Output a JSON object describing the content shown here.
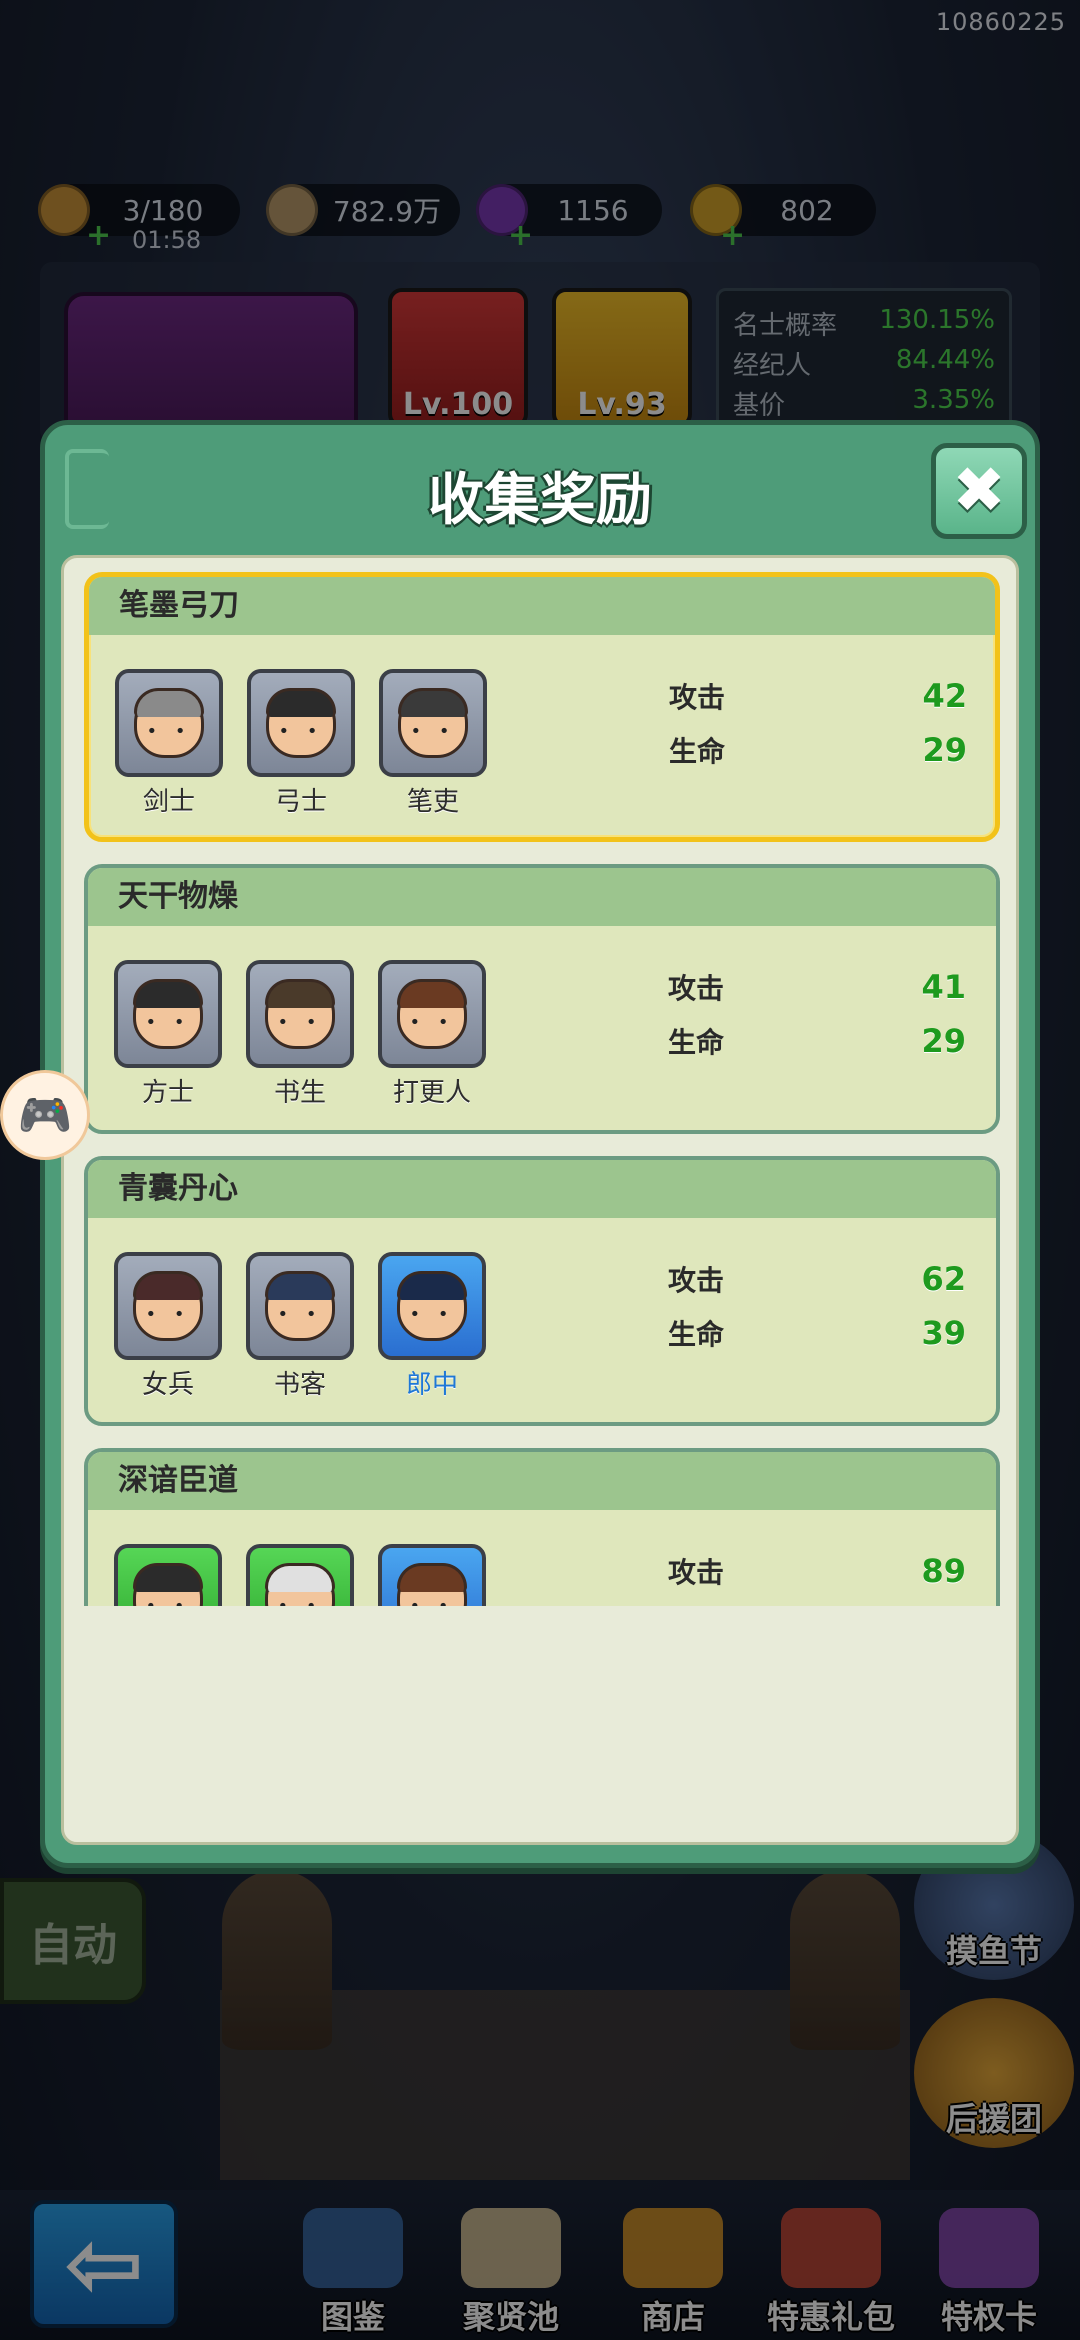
{
  "session_id": "10860225",
  "resources": {
    "stamina": {
      "value": "3/180",
      "timer": "01:58",
      "icon": "stamina-icon",
      "color": "#c9923a"
    },
    "coins": {
      "value": "782.9万",
      "icon": "coin-icon",
      "color": "#b89a6a"
    },
    "gems": {
      "value": "1156",
      "icon": "purple-gem-icon",
      "color": "#7a3ab4"
    },
    "tickets": {
      "value": "802",
      "icon": "ticket-icon",
      "color": "#d2a22a"
    }
  },
  "equipment": {
    "card1_level": "Lv.100",
    "card2_level": "Lv.93"
  },
  "stats_panel": [
    {
      "label": "名士概率",
      "value": "130.15%"
    },
    {
      "label": "经纪人",
      "value": "84.44%"
    },
    {
      "label": "基价",
      "value": "3.35%"
    }
  ],
  "modal": {
    "title": "收集奖励",
    "close_icon": "close-icon",
    "groups": [
      {
        "name": "笔墨弓刀",
        "highlighted": true,
        "heroes": [
          {
            "name": "剑士",
            "rarity": "gray"
          },
          {
            "name": "弓士",
            "rarity": "gray"
          },
          {
            "name": "笔吏",
            "rarity": "gray"
          }
        ],
        "attack_label": "攻击",
        "attack": "42",
        "hp_label": "生命",
        "hp": "29"
      },
      {
        "name": "天干物燥",
        "highlighted": false,
        "heroes": [
          {
            "name": "方士",
            "rarity": "gray"
          },
          {
            "name": "书生",
            "rarity": "gray"
          },
          {
            "name": "打更人",
            "rarity": "gray"
          }
        ],
        "attack_label": "攻击",
        "attack": "41",
        "hp_label": "生命",
        "hp": "29"
      },
      {
        "name": "青囊丹心",
        "highlighted": false,
        "heroes": [
          {
            "name": "女兵",
            "rarity": "gray"
          },
          {
            "name": "书客",
            "rarity": "gray"
          },
          {
            "name": "郎中",
            "rarity": "blue"
          }
        ],
        "attack_label": "攻击",
        "attack": "62",
        "hp_label": "生命",
        "hp": "39"
      },
      {
        "name": "深谙臣道",
        "highlighted": false,
        "heroes": [
          {
            "name": "",
            "rarity": "green"
          },
          {
            "name": "",
            "rarity": "green"
          },
          {
            "name": "",
            "rarity": "blue"
          }
        ],
        "attack_label": "攻击",
        "attack": "89",
        "hp_label": "",
        "hp": ""
      }
    ]
  },
  "auto_button": "自动",
  "side_buttons": {
    "fishing": "摸鱼节",
    "support": "后援团"
  },
  "bottom_nav": [
    "图鉴",
    "聚贤池",
    "商店",
    "特惠礼包",
    "特权卡"
  ],
  "back_icon": "back-arrow-icon"
}
